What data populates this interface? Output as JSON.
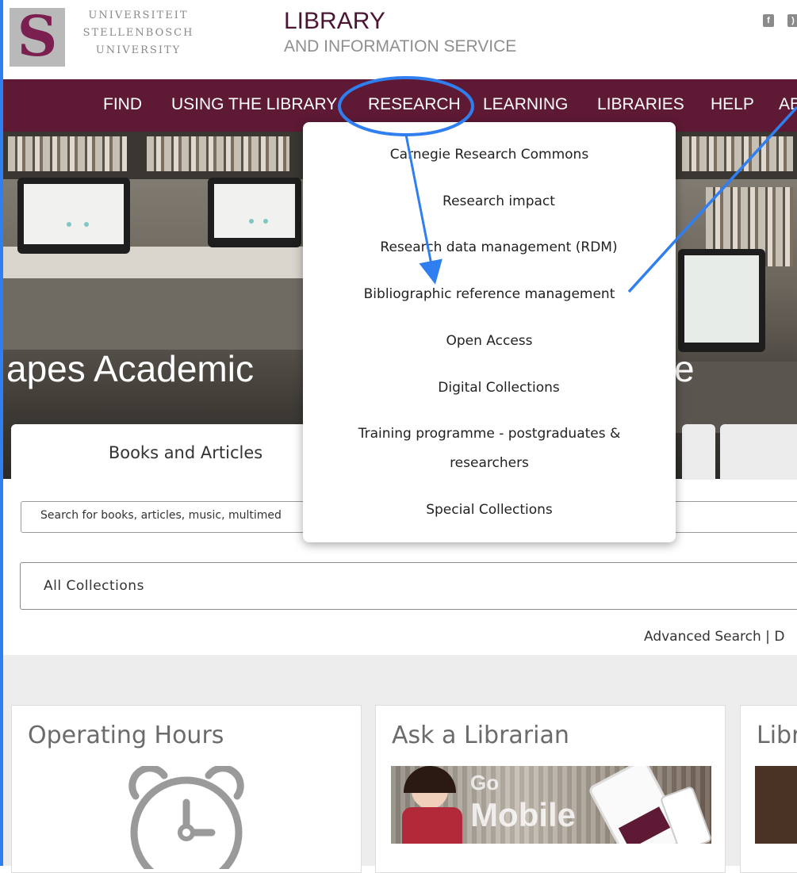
{
  "header": {
    "university_lines": [
      "UNIVERSITEIT",
      "STELLENBOSCH",
      "UNIVERSITY"
    ],
    "library_title": "LIBRARY",
    "library_subtitle": "AND INFORMATION SERVICE",
    "social_icons": [
      "facebook-icon",
      "rss-icon"
    ]
  },
  "nav": {
    "items": [
      {
        "label": "FIND"
      },
      {
        "label": "USING THE LIBRARY"
      },
      {
        "label": "RESEARCH"
      },
      {
        "label": "LEARNING"
      },
      {
        "label": "LIBRARIES"
      },
      {
        "label": "HELP"
      },
      {
        "label": "AB"
      }
    ]
  },
  "research_menu": {
    "items": [
      {
        "label": "Carnegie Research Commons"
      },
      {
        "label": "Research impact"
      },
      {
        "label": "Research data management (RDM)"
      },
      {
        "label": "Bibliographic reference management"
      },
      {
        "label": "Open Access"
      },
      {
        "label": "Digital Collections"
      },
      {
        "label": "Training programme - postgraduates &",
        "label2": "researchers"
      },
      {
        "label": "Special Collections"
      }
    ]
  },
  "hero": {
    "visible_text_left": "apes Academic",
    "visible_text_right": "e"
  },
  "search": {
    "active_tab": "Books and Articles",
    "placeholder": "Search for books, articles, music, multimed",
    "collection_selected": "All Collections",
    "advanced_link": "Advanced Search | D"
  },
  "cards": [
    {
      "title": "Operating Hours",
      "icon": "alarm-clock-icon"
    },
    {
      "title": "Ask a Librarian",
      "image_text": [
        "Go",
        "Mobile"
      ]
    },
    {
      "title": "Libr"
    }
  ],
  "colors": {
    "nav_bg": "#5e1934",
    "title_color": "#4b1634",
    "annotation_blue": "#2f7ff0"
  }
}
